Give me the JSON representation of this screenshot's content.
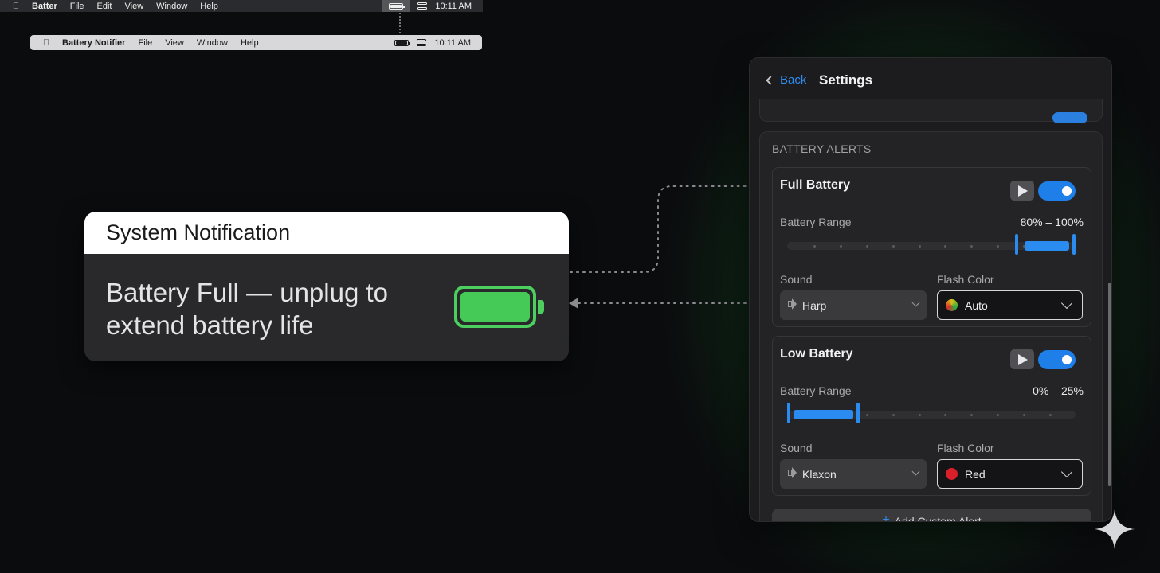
{
  "menubar_top": {
    "apple_icon": "apple-logo",
    "app_name": "Batter",
    "items": [
      "File",
      "Edit",
      "View",
      "Window",
      "Help"
    ],
    "time": "10:11 AM"
  },
  "menubar_preview": {
    "apple_icon": "apple-logo",
    "app_name": "Battery Notifier",
    "items": [
      "File",
      "View",
      "Window",
      "Help"
    ],
    "time": "10:11 AM"
  },
  "notification": {
    "header": "System Notification",
    "message": "Battery Full — unplug to extend battery life",
    "icon": "battery-full-icon",
    "icon_color": "#4ccf5e"
  },
  "settings": {
    "back_label": "Back",
    "title": "Settings",
    "section_label": "BATTERY ALERTS",
    "alerts": [
      {
        "title": "Full Battery",
        "enabled": true,
        "range_label": "Battery Range",
        "range_value": "80% – 100%",
        "range": [
          80,
          100
        ],
        "sound_label": "Sound",
        "sound_value": "Harp",
        "flash_label": "Flash Color",
        "flash_value": "Auto",
        "flash_swatch": "auto-multicolor"
      },
      {
        "title": "Low Battery",
        "enabled": true,
        "range_label": "Battery Range",
        "range_value": "0% – 25%",
        "range": [
          0,
          25
        ],
        "sound_label": "Sound",
        "sound_value": "Klaxon",
        "flash_label": "Flash Color",
        "flash_value": "Red",
        "flash_swatch": "#d81f2a"
      }
    ],
    "add_button_label": "Add Custom Alert"
  },
  "colors": {
    "accent": "#2a8cf0",
    "glow": "#2eaa46",
    "battery_green": "#45c957"
  }
}
